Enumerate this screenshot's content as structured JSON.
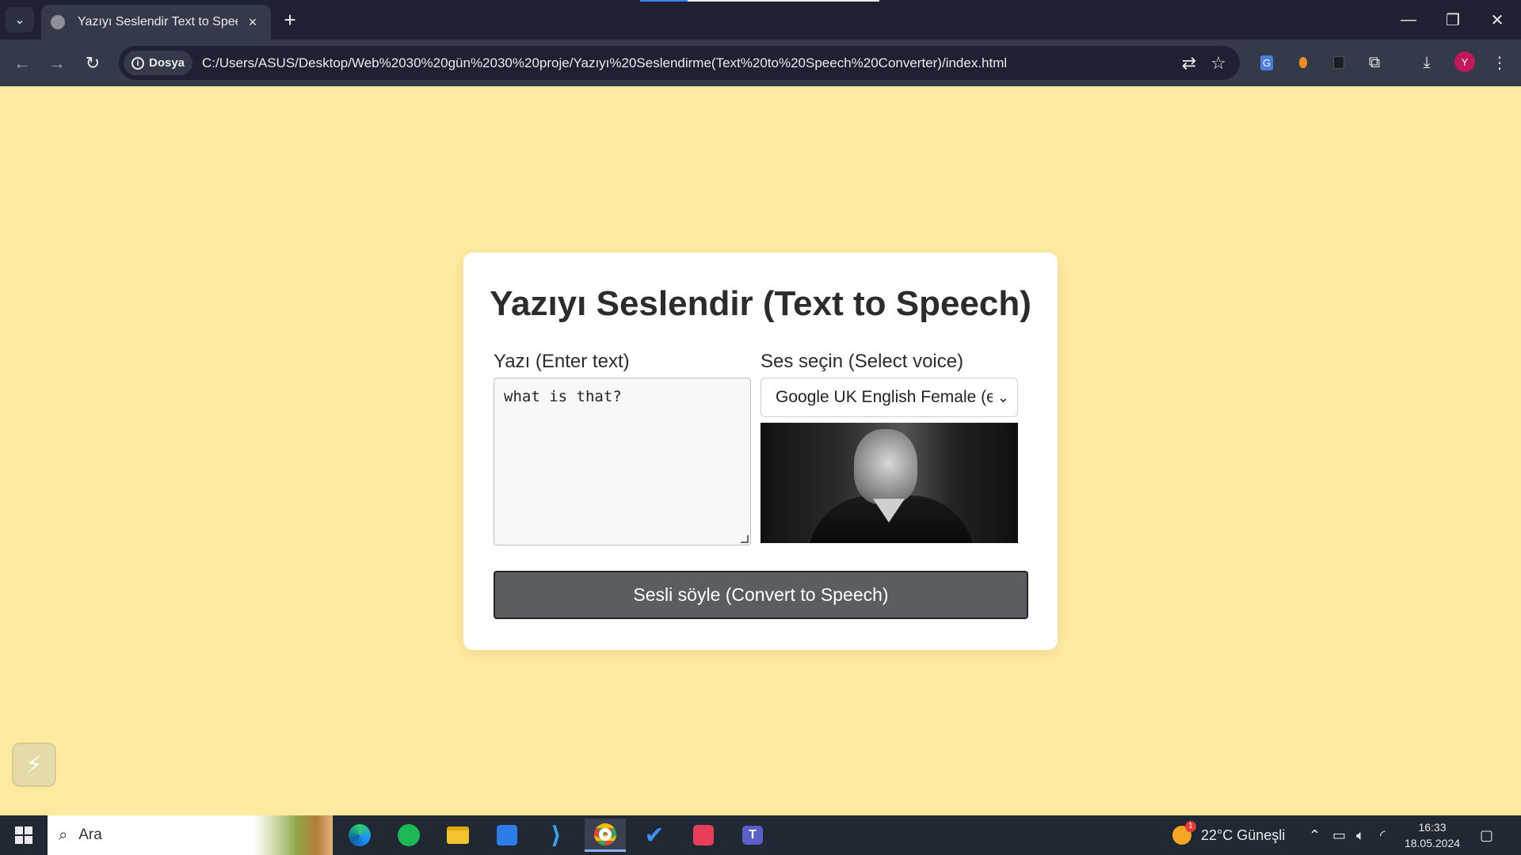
{
  "browser": {
    "tab_title": "Yazıyı Seslendir Text to Speech C",
    "tab_close": "×",
    "new_tab": "+",
    "site_chip": "Dosya",
    "url": "C:/Users/ASUS/Desktop/Web%2030%20gün%2030%20proje/Yazıyı%20Seslendirme(Text%20to%20Speech%20Converter)/index.html",
    "profile_initial": "Y",
    "accent_color": "#c2185b"
  },
  "page": {
    "title": "Yazıyı Seslendir (Text to Speech)",
    "text_label": "Yazı (Enter text)",
    "text_value": "what is that?",
    "voice_label": "Ses seçin (Select voice)",
    "voice_selected": "Google UK English Female (en",
    "convert_button": "Sesli söyle (Convert to Speech)",
    "background_color": "#ffeaa0",
    "button_color": "#5a5d62"
  },
  "taskbar": {
    "search_placeholder": "Ara",
    "weather": "22°C  Güneşli",
    "weather_badge": "1",
    "time": "16:33",
    "date": "18.05.2024"
  }
}
